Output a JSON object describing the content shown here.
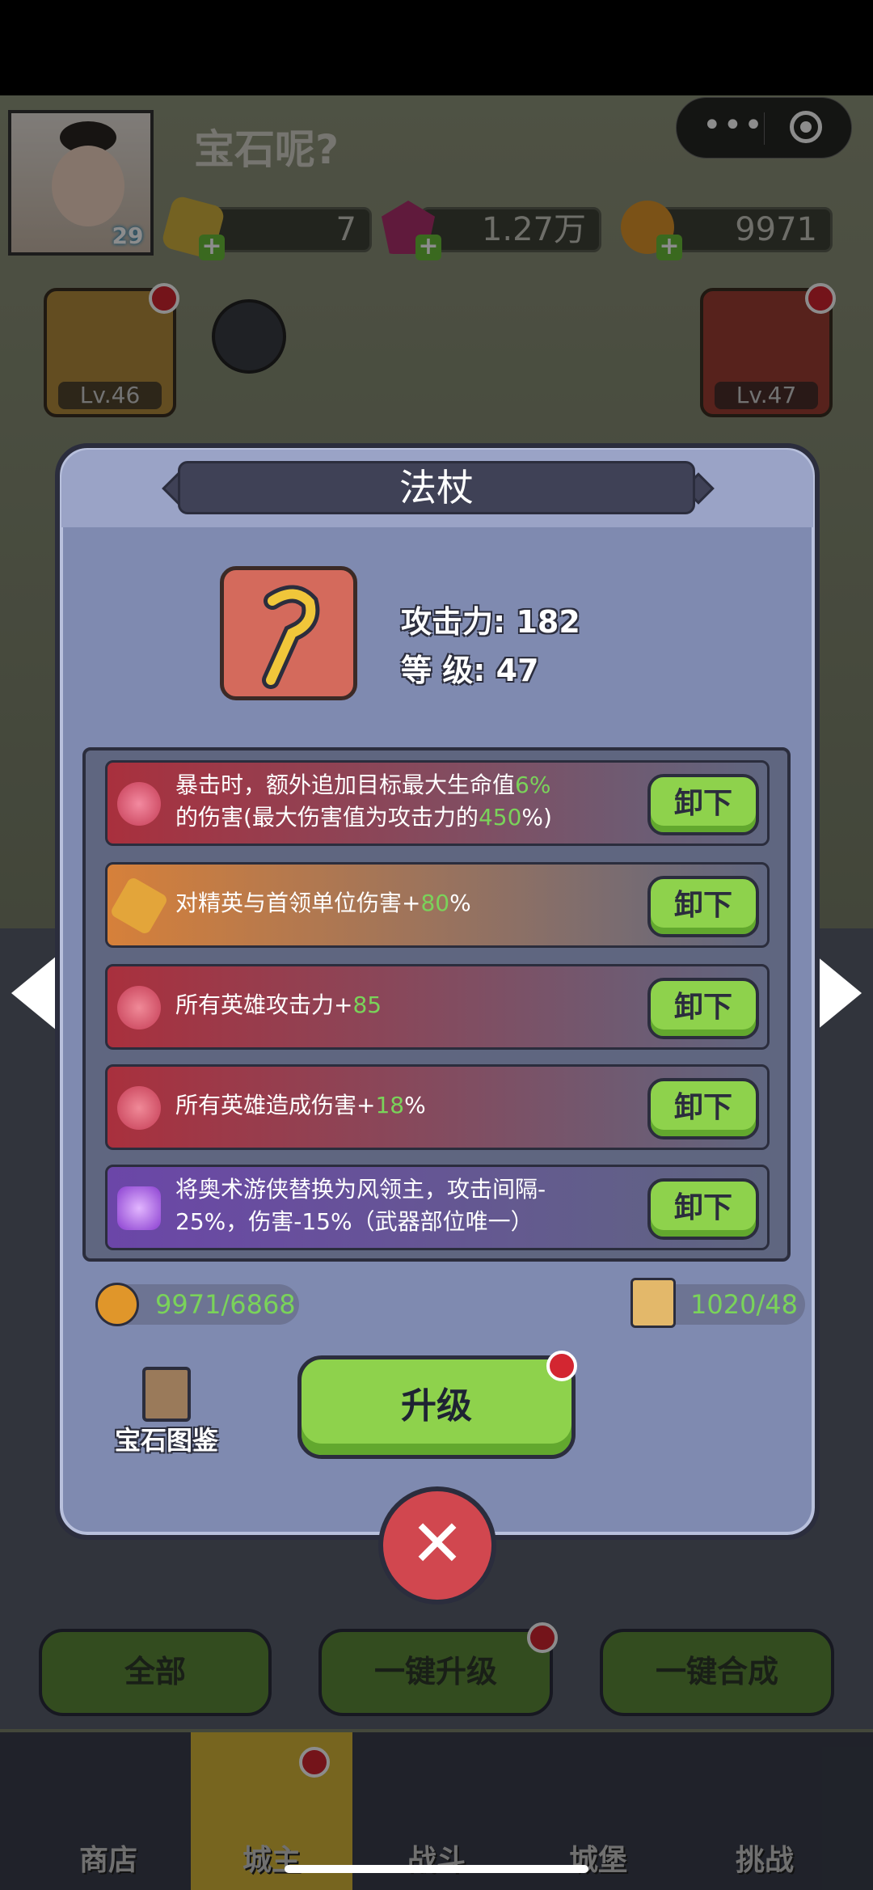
{
  "header": {
    "player_name": "宝石呢?",
    "player_level": "29",
    "resources": [
      {
        "icon": "gold-hexagon-icon",
        "value": "7"
      },
      {
        "icon": "purple-crystal-icon",
        "value": "1.27万"
      },
      {
        "icon": "coin-icon",
        "value": "9971"
      }
    ]
  },
  "side_tiles": {
    "left": {
      "icon": "crown-icon",
      "level": "Lv.46"
    },
    "right": {
      "icon": "staff-icon",
      "level": "Lv.47"
    }
  },
  "modal": {
    "title": "法杖",
    "attack_label": "攻击力:",
    "attack_value": "182",
    "level_label": "等 级:",
    "level_value": "47",
    "gems": [
      {
        "icon": "red-swirl-gem-icon",
        "text_a": "暴击时，额外追加目标最大生命值",
        "hl_a": "6%",
        "text_b": "的伤害(最大伤害值为攻击力的",
        "hl_b": "450",
        "text_c": "%)",
        "button": "卸下",
        "color": "#b0394a"
      },
      {
        "icon": "orange-hex-gem-icon",
        "text_a": "对精英与首领单位伤害+",
        "hl_a": "80",
        "text_b": "%",
        "button": "卸下",
        "color": "#d67b3a"
      },
      {
        "icon": "red-gem-icon",
        "text_a": "所有英雄攻击力+",
        "hl_a": "85",
        "button": "卸下",
        "color": "#b0394a"
      },
      {
        "icon": "red-gem-icon",
        "text_a": "所有英雄造成伤害+",
        "hl_a": "18",
        "text_b": "%",
        "button": "卸下",
        "color": "#b0394a"
      },
      {
        "icon": "purple-gem-icon",
        "text_a": "将奥术游侠替换为风领主，攻击间隔-",
        "text_b": "25%，伤害-15%（武器部位唯一）",
        "button": "卸下",
        "color": "#6f4fa8"
      }
    ],
    "coin_cost": "9971/6868",
    "scroll_cost": "1020/48",
    "gem_book_label": "宝石图鉴",
    "upgrade_label": "升级"
  },
  "bottom_buttons": {
    "all": "全部",
    "one_key_upgrade": "一键升级",
    "one_key_merge": "一键合成"
  },
  "nav": [
    {
      "label": "商店",
      "icon": "shop-icon"
    },
    {
      "label": "城主",
      "icon": "crown-icon"
    },
    {
      "label": "战斗",
      "icon": "swords-icon"
    },
    {
      "label": "城堡",
      "icon": "castle-icon"
    },
    {
      "label": "挑战",
      "icon": "demon-icon"
    }
  ]
}
